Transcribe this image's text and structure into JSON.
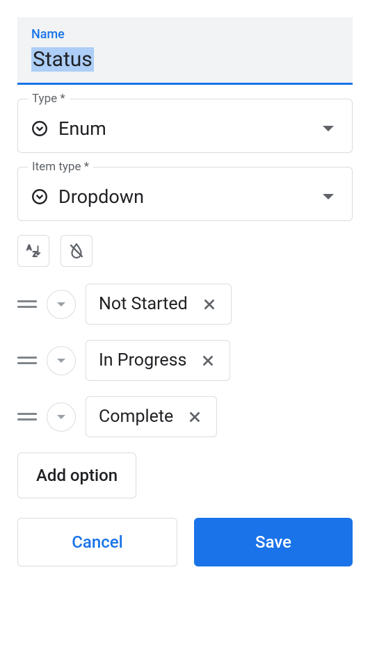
{
  "nameField": {
    "label": "Name",
    "value": "Status"
  },
  "typeField": {
    "label": "Type *",
    "value": "Enum"
  },
  "itemTypeField": {
    "label": "Item type *",
    "value": "Dropdown"
  },
  "options": [
    {
      "label": "Not Started"
    },
    {
      "label": "In Progress"
    },
    {
      "label": "Complete"
    }
  ],
  "buttons": {
    "addOption": "Add option",
    "cancel": "Cancel",
    "save": "Save"
  }
}
